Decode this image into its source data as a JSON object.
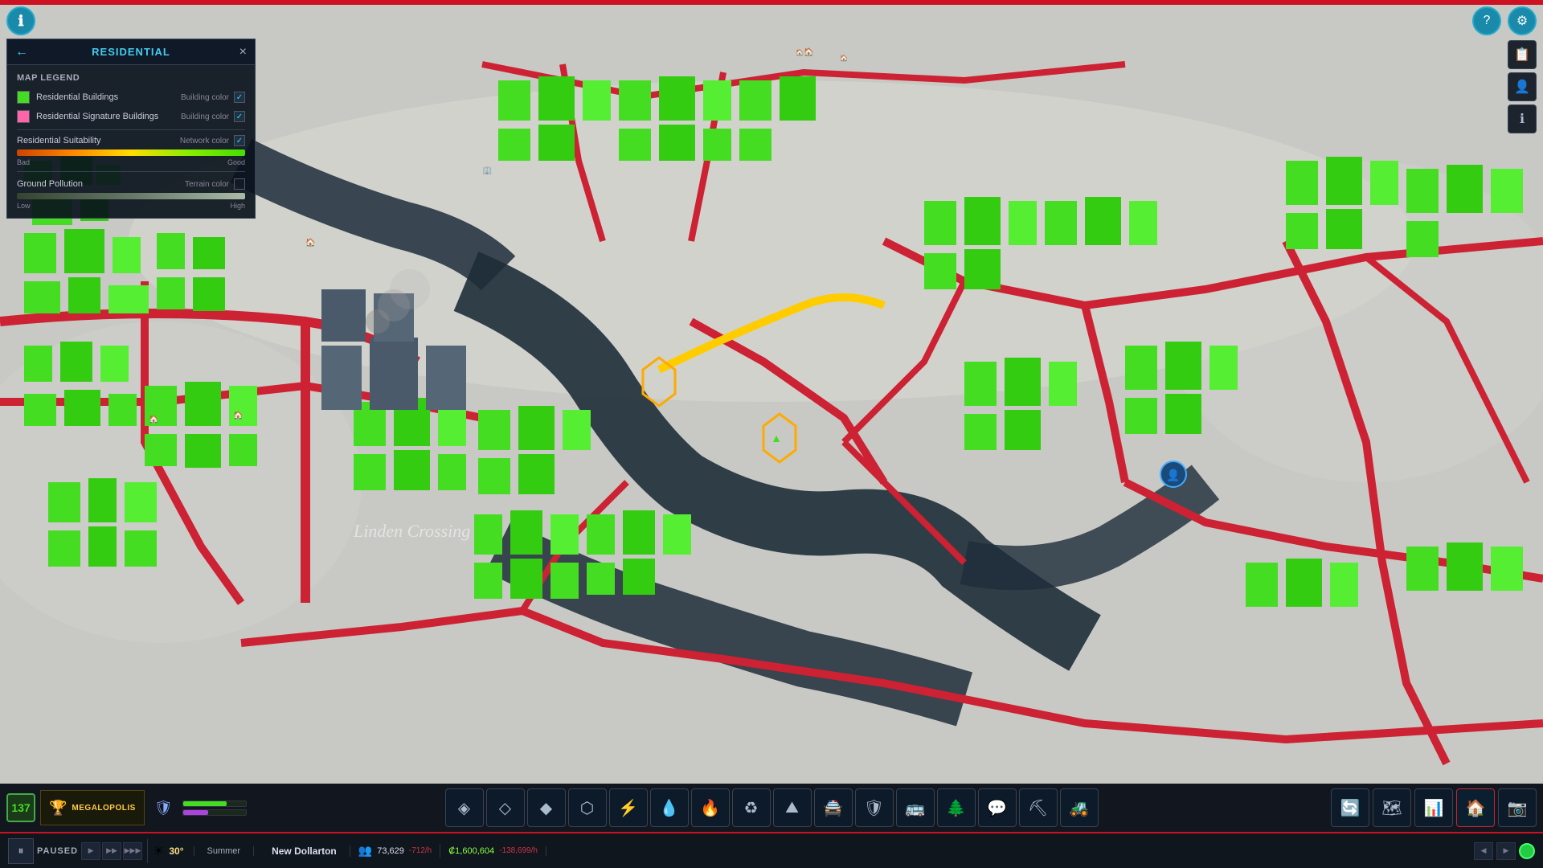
{
  "top": {
    "info_btn": "ℹ",
    "help_btn": "?",
    "settings_btn": "⚙"
  },
  "panel": {
    "title": "RESIDENTIAL",
    "back_arrow": "←",
    "close_btn": "×",
    "legend_title": "MAP LEGEND",
    "items": [
      {
        "label": "Residential Buildings",
        "type_label": "Building color",
        "color": "#44dd22",
        "checked": true
      },
      {
        "label": "Residential Signature Buildings",
        "type_label": "Building color",
        "color": "#ff66aa",
        "checked": true
      }
    ],
    "suitability": {
      "label": "Residential Suitability",
      "type_label": "Network color",
      "checked": true,
      "bad_label": "Bad",
      "good_label": "Good"
    },
    "pollution": {
      "label": "Ground Pollution",
      "type_label": "Terrain color",
      "checked": false,
      "low_label": "Low",
      "high_label": "High"
    }
  },
  "toolbar": {
    "city_level": "137",
    "trophy_label": "MEGALOPOLIS",
    "tools": [
      {
        "icon": "◈",
        "label": "zones"
      },
      {
        "icon": "◇",
        "label": "signature"
      },
      {
        "icon": "◆",
        "label": "assets"
      },
      {
        "icon": "⬡",
        "label": "roads"
      },
      {
        "icon": "⚡",
        "label": "electricity"
      },
      {
        "icon": "💧",
        "label": "water"
      },
      {
        "icon": "🔥",
        "label": "fire"
      },
      {
        "icon": "♻",
        "label": "garbage"
      },
      {
        "icon": "🏔",
        "label": "terrain"
      },
      {
        "icon": "🔫",
        "label": "police"
      },
      {
        "icon": "🛡",
        "label": "emergency"
      },
      {
        "icon": "🚌",
        "label": "transit"
      },
      {
        "icon": "🌲",
        "label": "parks"
      },
      {
        "icon": "💬",
        "label": "communication"
      },
      {
        "icon": "⛏",
        "label": "industry"
      },
      {
        "icon": "🚜",
        "label": "agriculture"
      }
    ],
    "right_tools": [
      {
        "icon": "🔄",
        "label": "progression"
      },
      {
        "icon": "🗺",
        "label": "map"
      },
      {
        "icon": "📊",
        "label": "statistics"
      },
      {
        "icon": "🏠",
        "label": "residential"
      },
      {
        "icon": "📷",
        "label": "photo"
      }
    ]
  },
  "status_bar": {
    "pause_icon": "⏸",
    "paused_label": "PAUSED",
    "speed_arrows": "▶▶",
    "weather_icon": "☀",
    "temperature": "30°",
    "season": "Summer",
    "city_name": "New Dollarton",
    "population_icon": "👥",
    "population": "73,629",
    "pop_change": "-712/h",
    "money_icon": "₡",
    "money": "₡1,600,604",
    "money_change": "-138,699/h",
    "speed_btns": [
      "◀◀",
      "▶",
      "▶▶",
      "▶▶▶"
    ],
    "status_dot": "●"
  }
}
